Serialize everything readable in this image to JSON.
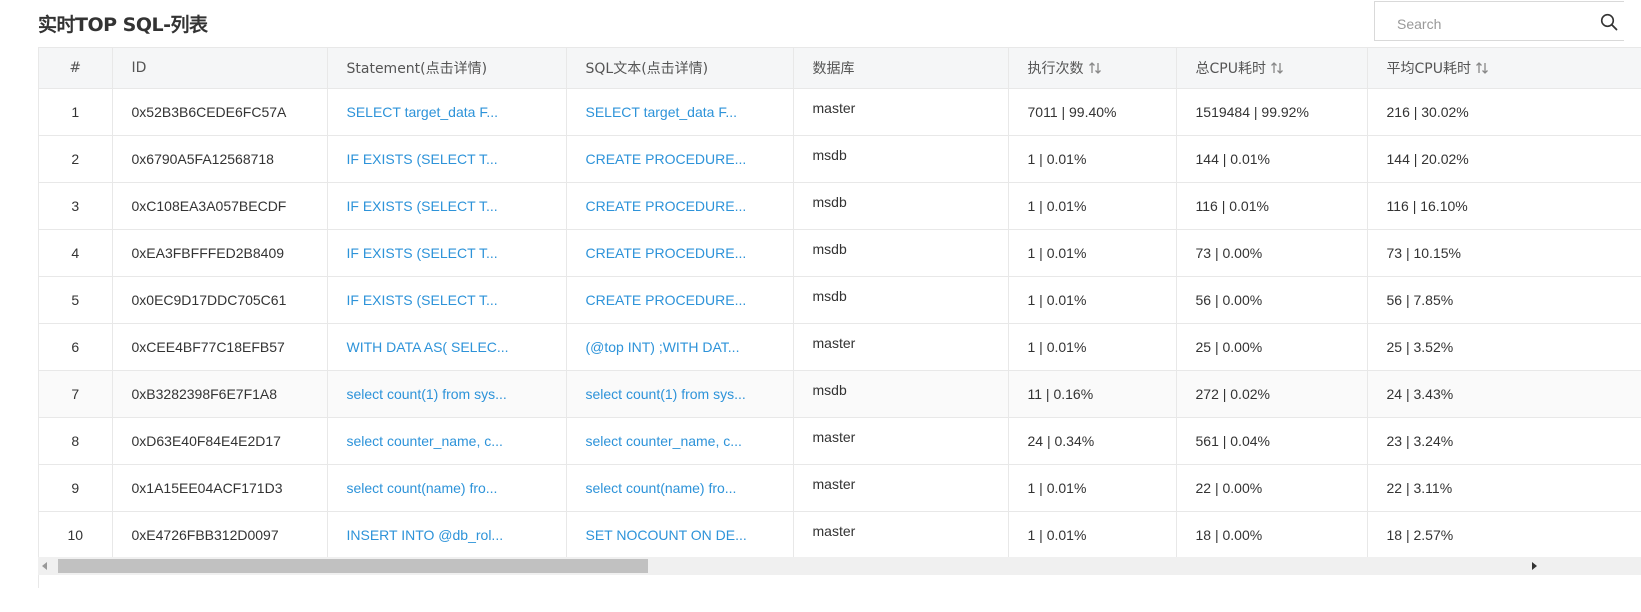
{
  "title": "实时TOP SQL-列表",
  "search": {
    "placeholder": "Search"
  },
  "columns": [
    "#",
    "ID",
    "Statement(点击详情)",
    "SQL文本(点击详情)",
    "数据库",
    "执行次数",
    "总CPU耗时",
    "平均CPU耗时"
  ],
  "rows": [
    {
      "n": "1",
      "id": "0x52B3B6CEDE6FC57A",
      "statement": "SELECT target_data F...",
      "sql": "SELECT target_data F...",
      "db": "master",
      "exec": "7011 | 99.40%",
      "total_cpu": "1519484 | 99.92%",
      "avg_cpu": "216 | 30.02%"
    },
    {
      "n": "2",
      "id": "0x6790A5FA12568718",
      "statement": "IF EXISTS (SELECT T...",
      "sql": "CREATE PROCEDURE...",
      "db": "msdb",
      "exec": "1 | 0.01%",
      "total_cpu": "144 | 0.01%",
      "avg_cpu": "144 | 20.02%"
    },
    {
      "n": "3",
      "id": "0xC108EA3A057BECDF",
      "statement": "IF EXISTS (SELECT T...",
      "sql": "CREATE PROCEDURE...",
      "db": "msdb",
      "exec": "1 | 0.01%",
      "total_cpu": "116 | 0.01%",
      "avg_cpu": "116 | 16.10%"
    },
    {
      "n": "4",
      "id": "0xEA3FBFFFED2B8409",
      "statement": "IF EXISTS (SELECT T...",
      "sql": "CREATE PROCEDURE...",
      "db": "msdb",
      "exec": "1 | 0.01%",
      "total_cpu": "73 | 0.00%",
      "avg_cpu": "73 | 10.15%"
    },
    {
      "n": "5",
      "id": "0x0EC9D17DDC705C61",
      "statement": "IF EXISTS (SELECT T...",
      "sql": "CREATE PROCEDURE...",
      "db": "msdb",
      "exec": "1 | 0.01%",
      "total_cpu": "56 | 0.00%",
      "avg_cpu": "56 | 7.85%"
    },
    {
      "n": "6",
      "id": "0xCEE4BF77C18EFB57",
      "statement": "WITH DATA AS( SELEC...",
      "sql": "(@top INT) ;WITH DAT...",
      "db": "master",
      "exec": "1 | 0.01%",
      "total_cpu": "25 | 0.00%",
      "avg_cpu": "25 | 3.52%"
    },
    {
      "n": "7",
      "id": "0xB3282398F6E7F1A8",
      "statement": "select count(1) from sys...",
      "sql": "select count(1) from sys...",
      "db": "msdb",
      "exec": "11 | 0.16%",
      "total_cpu": "272 | 0.02%",
      "avg_cpu": "24 | 3.43%"
    },
    {
      "n": "8",
      "id": "0xD63E40F84E4E2D17",
      "statement": "select counter_name, c...",
      "sql": "select counter_name, c...",
      "db": "master",
      "exec": "24 | 0.34%",
      "total_cpu": "561 | 0.04%",
      "avg_cpu": "23 | 3.24%"
    },
    {
      "n": "9",
      "id": "0x1A15EE04ACF171D3",
      "statement": "select count(name) fro...",
      "sql": "select count(name) fro...",
      "db": "master",
      "exec": "1 | 0.01%",
      "total_cpu": "22 | 0.00%",
      "avg_cpu": "22 | 3.11%"
    },
    {
      "n": "10",
      "id": "0xE4726FBB312D0097",
      "statement": "INSERT INTO @db_rol...",
      "sql": "SET NOCOUNT ON DE...",
      "db": "master",
      "exec": "1 | 0.01%",
      "total_cpu": "18 | 0.00%",
      "avg_cpu": "18 | 2.57%"
    }
  ],
  "colors": {
    "link": "#2d93d9",
    "header_bg": "#f5f6f7",
    "border": "#e8e8e8"
  },
  "icons": {
    "search": "search-icon",
    "sort": "sort-icon"
  }
}
